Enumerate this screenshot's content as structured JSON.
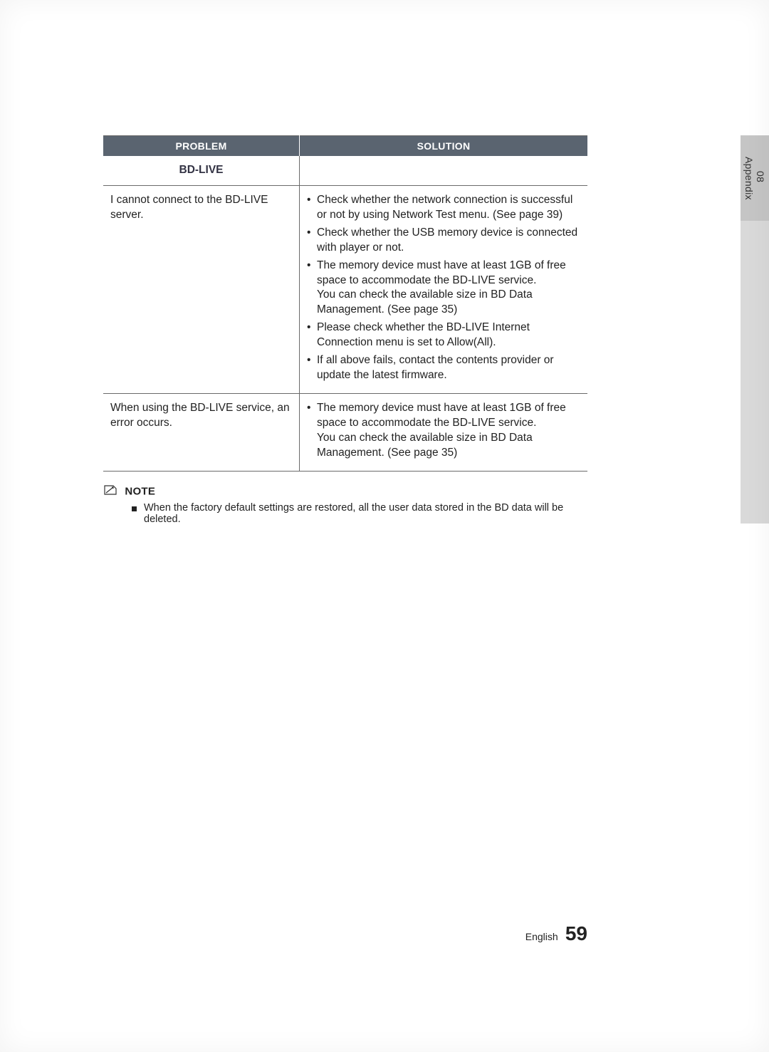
{
  "sidebar": {
    "number": "08",
    "section": "Appendix"
  },
  "table": {
    "header_problem": "PROBLEM",
    "header_solution": "SOLUTION",
    "subhead": "BD-LIVE",
    "row1": {
      "problem": "I cannot connect to the BD-LIVE server.",
      "sol1": "Check whether the network connection is successful or not by using Network Test menu. (See page 39)",
      "sol2": "Check whether the USB memory device is connected with player or not.",
      "sol3a": "The memory device must have at least 1GB of free space to accommodate the BD-LIVE service.",
      "sol3b": "You can check the available size in BD Data Management. (See page 35)",
      "sol4": "Please check whether the BD-LIVE Internet Connection menu is set to Allow(All).",
      "sol5": "If all above fails, contact the contents provider or update the latest firmware."
    },
    "row2": {
      "problem": "When using the BD-LIVE service, an error occurs.",
      "sol1a": "The memory device must have at least 1GB of free space to accommodate the BD-LIVE service.",
      "sol1b": "You can check the available size in BD Data Management. (See page 35)"
    }
  },
  "note": {
    "label": "NOTE",
    "item1": "When the factory default settings are restored, all the user data stored in the BD data will be deleted."
  },
  "footer": {
    "language": "English",
    "page_number": "59"
  }
}
